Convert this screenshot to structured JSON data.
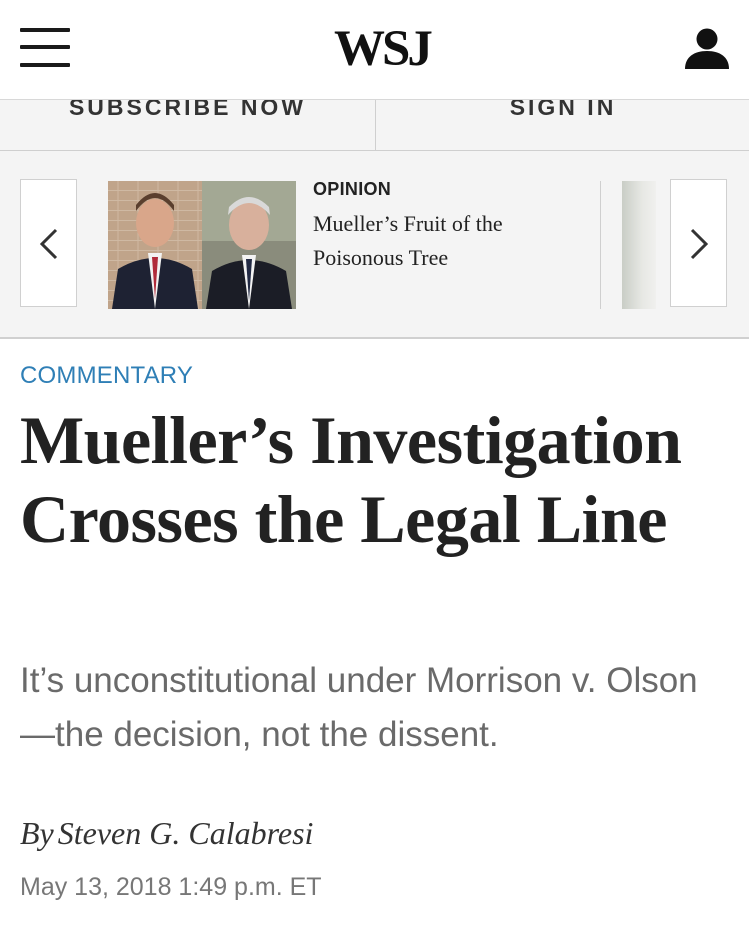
{
  "header": {
    "logo": "WSJ",
    "menu_icon": "hamburger-menu-icon",
    "user_icon": "user-account-icon"
  },
  "subscribe_bar": {
    "subscribe_label": "SUBSCRIBE NOW",
    "signin_label": "SIGN IN"
  },
  "carousel": {
    "kicker": "OPINION",
    "title": "Mueller’s Fruit of the Poisonous Tree",
    "prev_icon": "chevron-left-icon",
    "next_icon": "chevron-right-icon"
  },
  "article": {
    "section": "COMMENTARY",
    "headline": "Mueller’s Investigation Crosses the Legal Line",
    "dek": "It’s unconstitutional under Morrison v. Olson—the decision, not the dissent.",
    "byline_prefix": "By",
    "author": "Steven G. Calabresi",
    "date": "May 13, 2018 1:49 p.m. ET"
  },
  "colors": {
    "accent_link": "#2f7fb6",
    "headline": "#222222",
    "dek": "#6a6a6a"
  }
}
